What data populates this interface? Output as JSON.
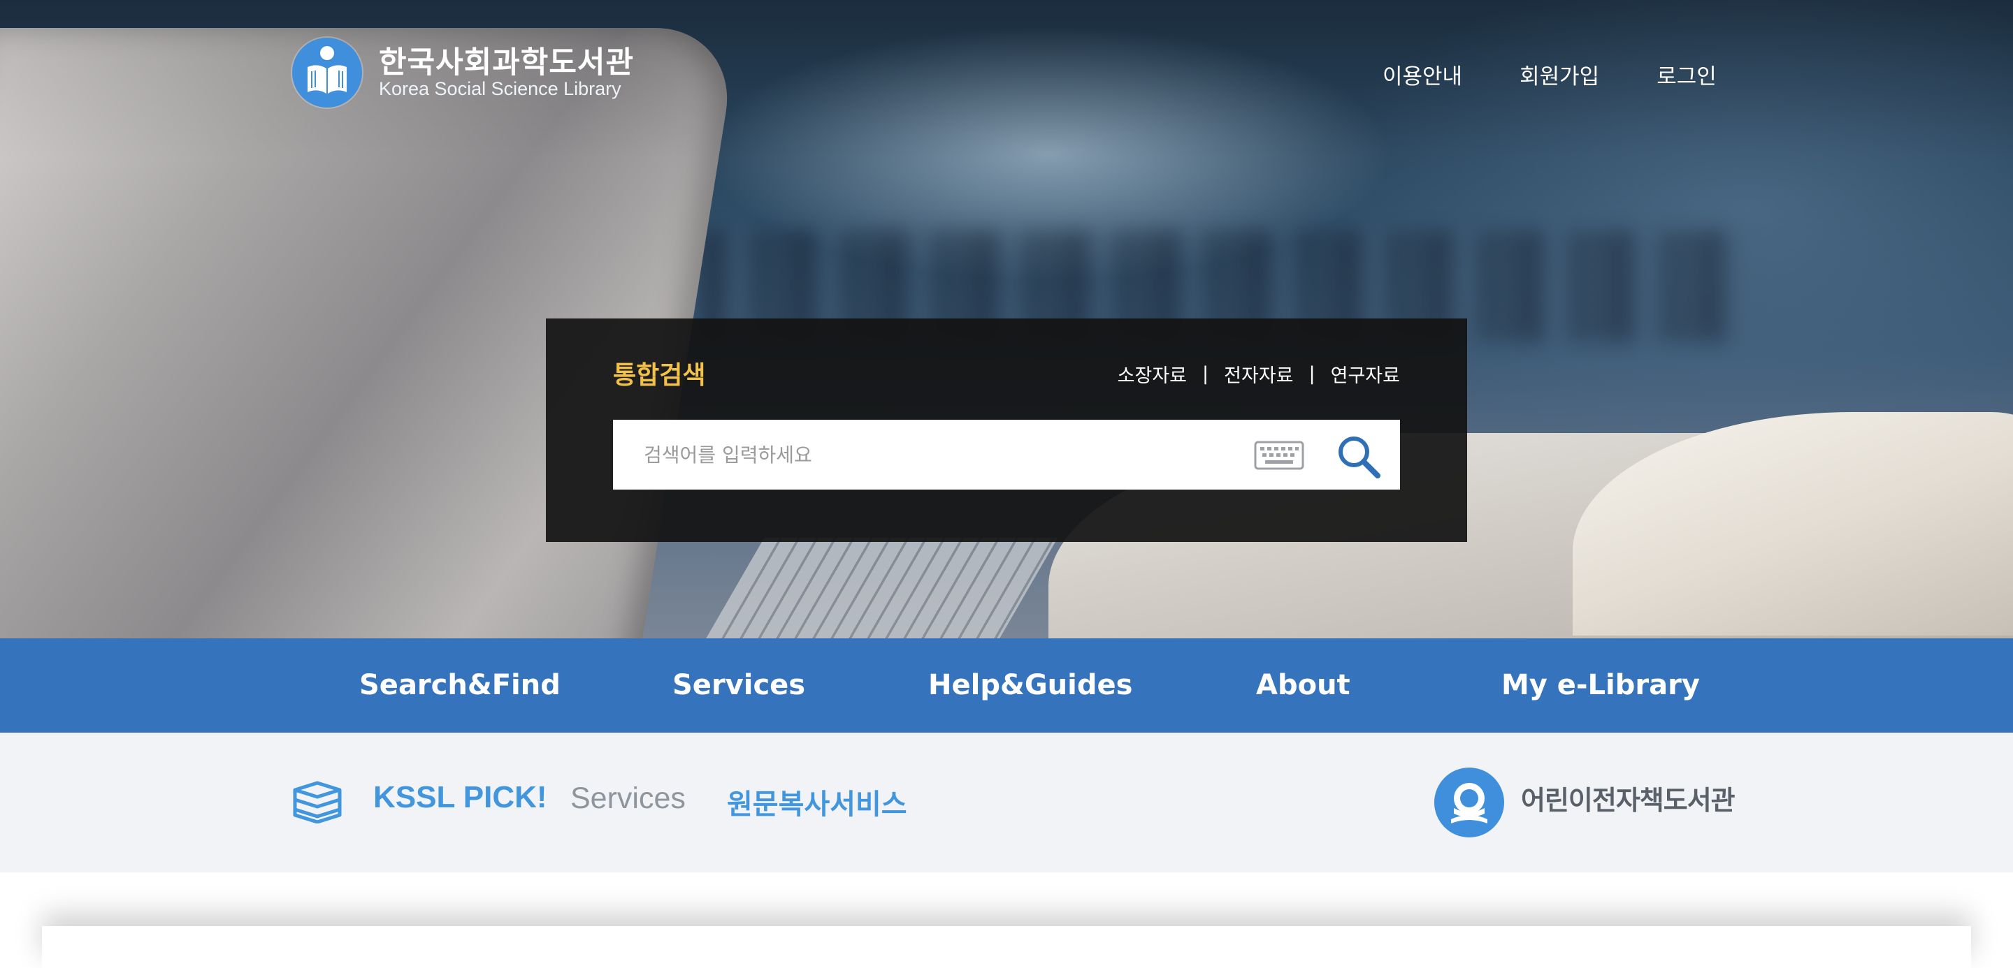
{
  "header": {
    "logo_ko": "한국사회과학도서관",
    "logo_en": "Korea Social Science Library",
    "links": [
      {
        "label": "이용안내"
      },
      {
        "label": "회원가입"
      },
      {
        "label": "로그인"
      }
    ]
  },
  "search": {
    "title": "통합검색",
    "tabs": [
      {
        "label": "소장자료"
      },
      {
        "label": "전자자료"
      },
      {
        "label": "연구자료"
      }
    ],
    "separator": "|",
    "placeholder": "검색어를 입력하세요",
    "keyboard_icon": "keyboard-icon",
    "search_icon": "search-icon"
  },
  "nav": {
    "items": [
      {
        "label": "Search&Find"
      },
      {
        "label": "Services"
      },
      {
        "label": "Help&Guides"
      },
      {
        "label": "About"
      },
      {
        "label": "My e-Library"
      }
    ]
  },
  "pick": {
    "icon": "stacked-books-icon",
    "title": "KSSL PICK!",
    "category": "Services",
    "link": "원문복사서비스",
    "kids_icon": "child-reader-icon",
    "kids_label": "어린이전자책도서관"
  },
  "colors": {
    "nav_blue": "#3574bc",
    "accent_blue": "#4196dd",
    "search_title_yellow": "#f2c14a",
    "search_panel": "#121212",
    "pick_bar_bg": "#f1f3f6"
  }
}
